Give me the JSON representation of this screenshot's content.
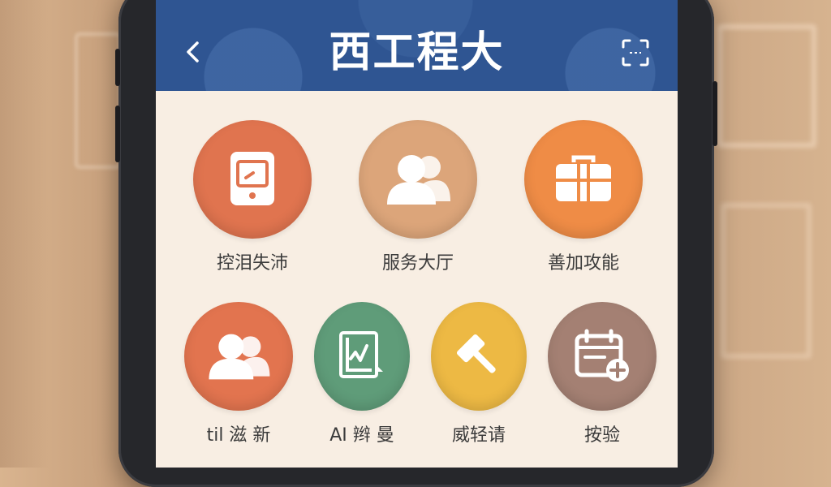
{
  "header": {
    "title": "西工程大",
    "back_label": "‹"
  },
  "row1": [
    {
      "label": "控泪失沛",
      "icon": "tablet-icon",
      "color": "#e0744f"
    },
    {
      "label": "服务大厅",
      "icon": "users-icon",
      "color": "#dca57a"
    },
    {
      "label": "善加攻能",
      "icon": "toolbox-icon",
      "color": "#ef8c46"
    }
  ],
  "row2": [
    {
      "label": "til 滋 新",
      "icon": "users-icon",
      "color": "#e2744f"
    },
    {
      "label": "AI 辫 曼",
      "icon": "chart-document-icon",
      "color": "#5f9c79"
    },
    {
      "label": "威轻请",
      "icon": "hammer-icon",
      "color": "#edb944"
    },
    {
      "label": "按验",
      "icon": "calendar-add-icon",
      "color": "#a48073"
    }
  ],
  "colors": {
    "header_bg": "#2f5592",
    "screen_bg": "#f8eee3"
  }
}
